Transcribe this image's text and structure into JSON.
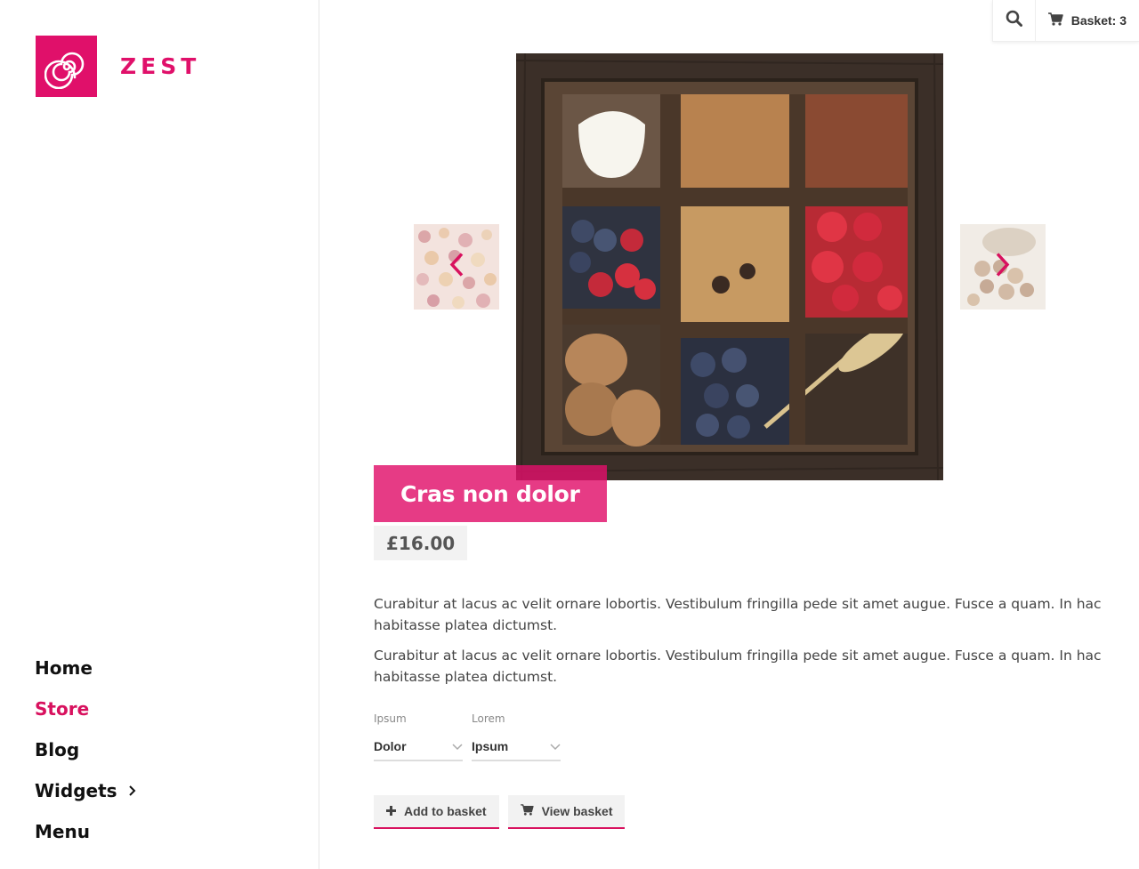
{
  "brand": {
    "name": "ZEST",
    "color": "#e0106a"
  },
  "nav": {
    "items": [
      {
        "label": "Home"
      },
      {
        "label": "Store"
      },
      {
        "label": "Blog"
      },
      {
        "label": "Widgets"
      },
      {
        "label": "Menu"
      }
    ],
    "active": "Store"
  },
  "topbar": {
    "basket_label": "Basket: 3",
    "search_icon": "search-icon",
    "cart_icon": "cart-icon"
  },
  "product": {
    "title": "Cras non dolor",
    "price": "£16.00",
    "description": [
      "Curabitur at lacus ac velit ornare lobortis. Vestibulum fringilla pede sit amet augue. Fusce a quam. In hac habitasse platea dictumst.",
      "Curabitur at lacus ac velit ornare lobortis. Vestibulum fringilla pede sit amet augue. Fusce a quam. In hac habitasse platea dictumst."
    ],
    "options": [
      {
        "label": "Ipsum",
        "value": "Dolor"
      },
      {
        "label": "Lorem",
        "value": "Ipsum"
      }
    ],
    "buttons": {
      "add": "Add to basket",
      "view": "View basket"
    }
  },
  "gallery": {
    "prev_icon": "chevron-left-icon",
    "next_icon": "chevron-right-icon"
  }
}
